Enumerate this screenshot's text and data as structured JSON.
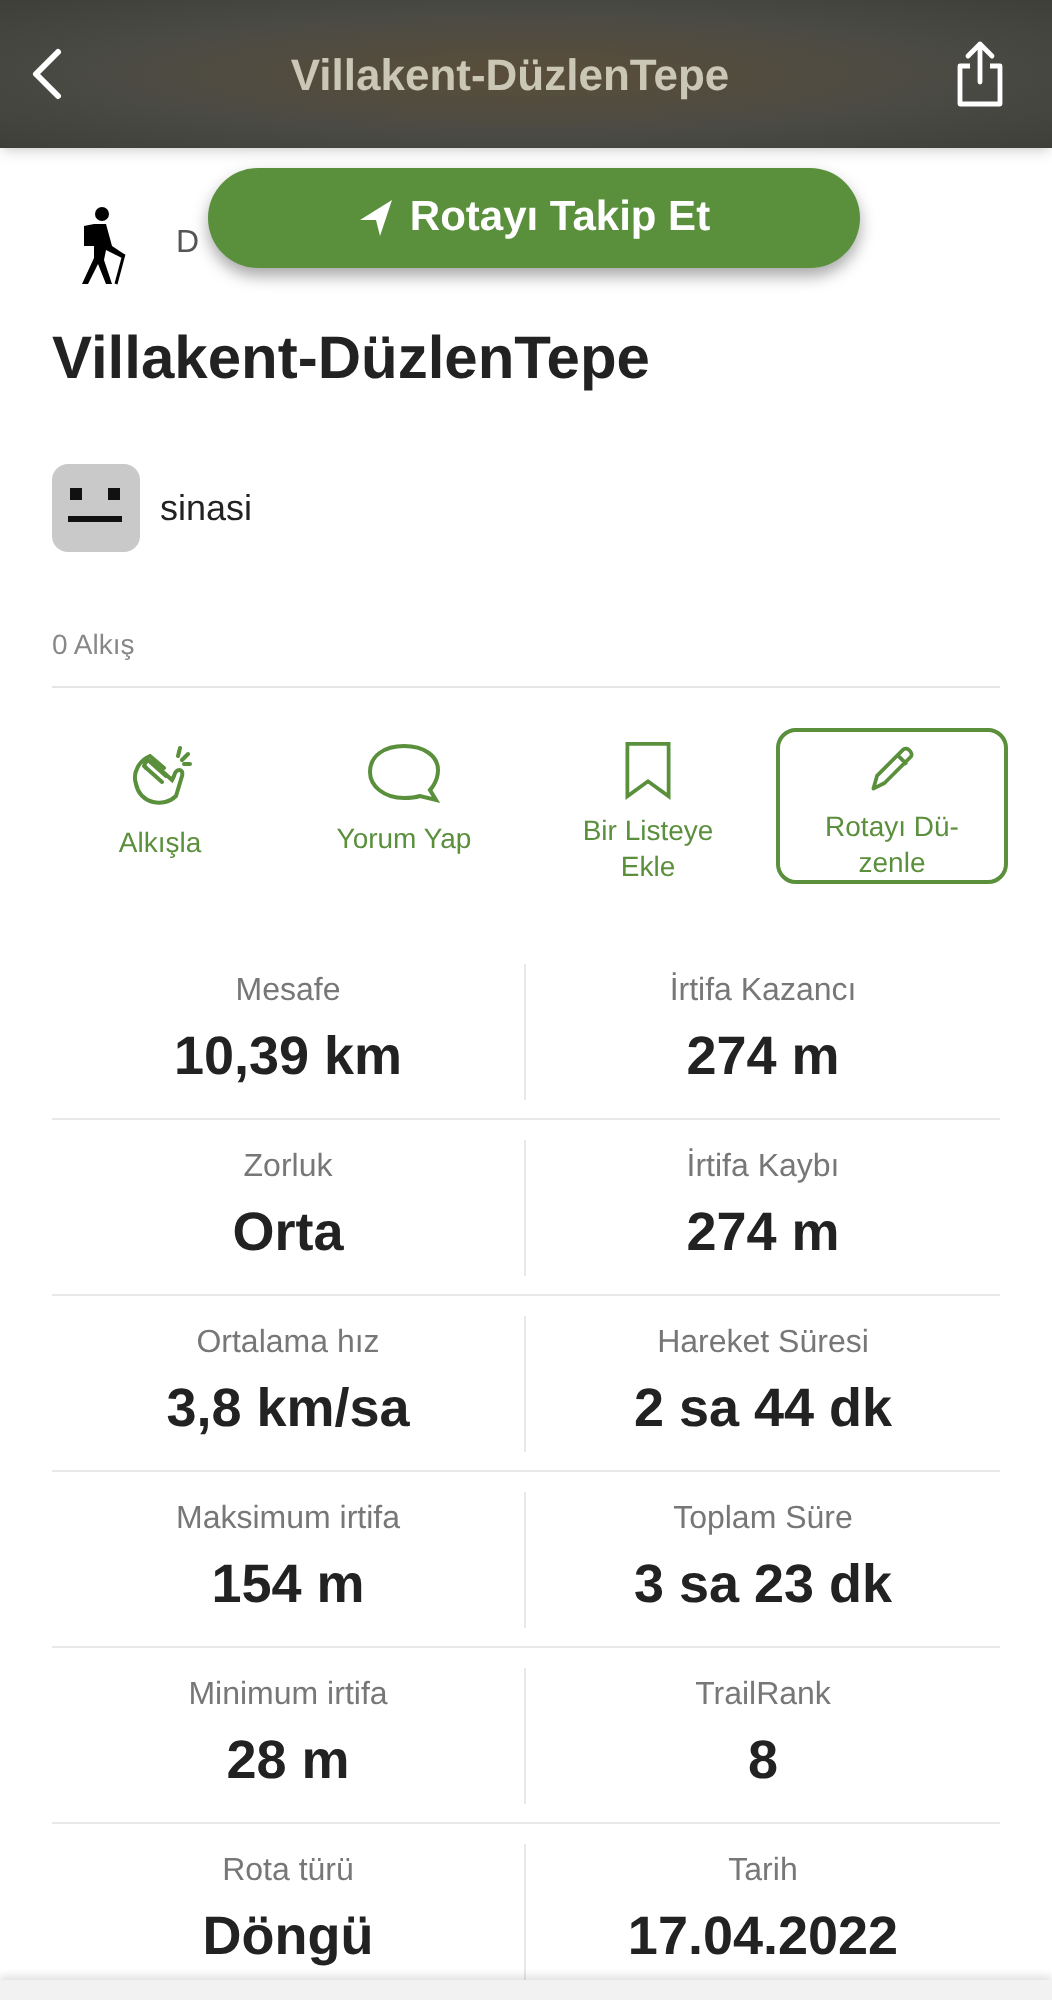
{
  "header": {
    "title": "Villakent-DüzlenTepe"
  },
  "follow_button": {
    "label": "Rotayı Takip Et"
  },
  "activity": {
    "label_partial": "D"
  },
  "route_title": "Villakent-DüzlenTepe",
  "author": {
    "name": "sinasi"
  },
  "applause_count": "0 Alkış",
  "actions": [
    {
      "kind": "clap",
      "label": "Alkışla",
      "outlined": false
    },
    {
      "kind": "comment",
      "label": "Yorum Yap",
      "outlined": false
    },
    {
      "kind": "bookmark",
      "label": "Bir Listeye Ekle",
      "outlined": false
    },
    {
      "kind": "edit",
      "label": "Rotayı Dü-zenle",
      "outlined": true
    }
  ],
  "stats": [
    {
      "label": "Mesafe",
      "value": "10,39 km"
    },
    {
      "label": "İrtifa Kazancı",
      "value": "274 m"
    },
    {
      "label": "Zorluk",
      "value": "Orta"
    },
    {
      "label": "İrtifa Kaybı",
      "value": "274 m"
    },
    {
      "label": "Ortalama hız",
      "value": "3,8 km/sa"
    },
    {
      "label": "Hareket Süresi",
      "value": "2 sa 44 dk"
    },
    {
      "label": "Maksimum irtifa",
      "value": "154 m"
    },
    {
      "label": "Toplam Süre",
      "value": "3 sa 23 dk"
    },
    {
      "label": "Minimum irtifa",
      "value": "28 m"
    },
    {
      "label": "TrailRank",
      "value": "8"
    },
    {
      "label": "Rota türü",
      "value": "Döngü"
    },
    {
      "label": "Tarih",
      "value": "17.04.2022"
    }
  ]
}
